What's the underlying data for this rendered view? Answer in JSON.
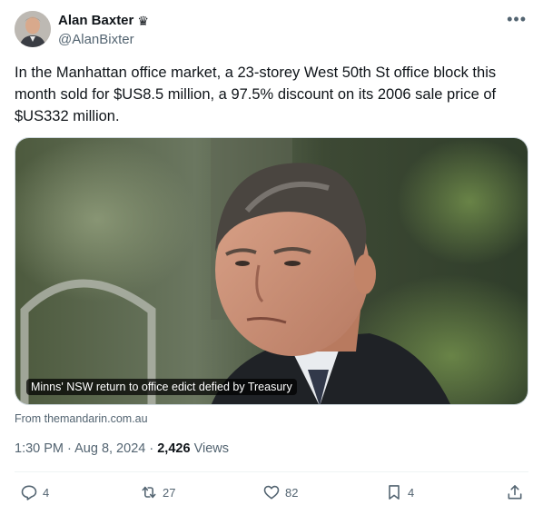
{
  "author": {
    "display_name": "Alan Baxter",
    "badge_icon": "crown-icon",
    "handle": "@AlanBixter"
  },
  "tweet": {
    "text": "In the Manhattan office market, a 23-storey West 50th St office block this month sold for $US8.5 million, a 97.5% discount on its 2006 sale price of $US332 million."
  },
  "card": {
    "caption": "Minns' NSW return to office edict defied by Treasury",
    "source": "From themandarin.com.au"
  },
  "meta": {
    "time": "1:30 PM",
    "separator": "·",
    "date": "Aug 8, 2024",
    "views_count": "2,426",
    "views_label": "Views"
  },
  "actions": {
    "replies": "4",
    "reposts": "27",
    "likes": "82",
    "bookmarks": "4"
  },
  "colors": {
    "text_primary": "#0f1419",
    "text_secondary": "#536471",
    "divider": "#eff3f4"
  }
}
